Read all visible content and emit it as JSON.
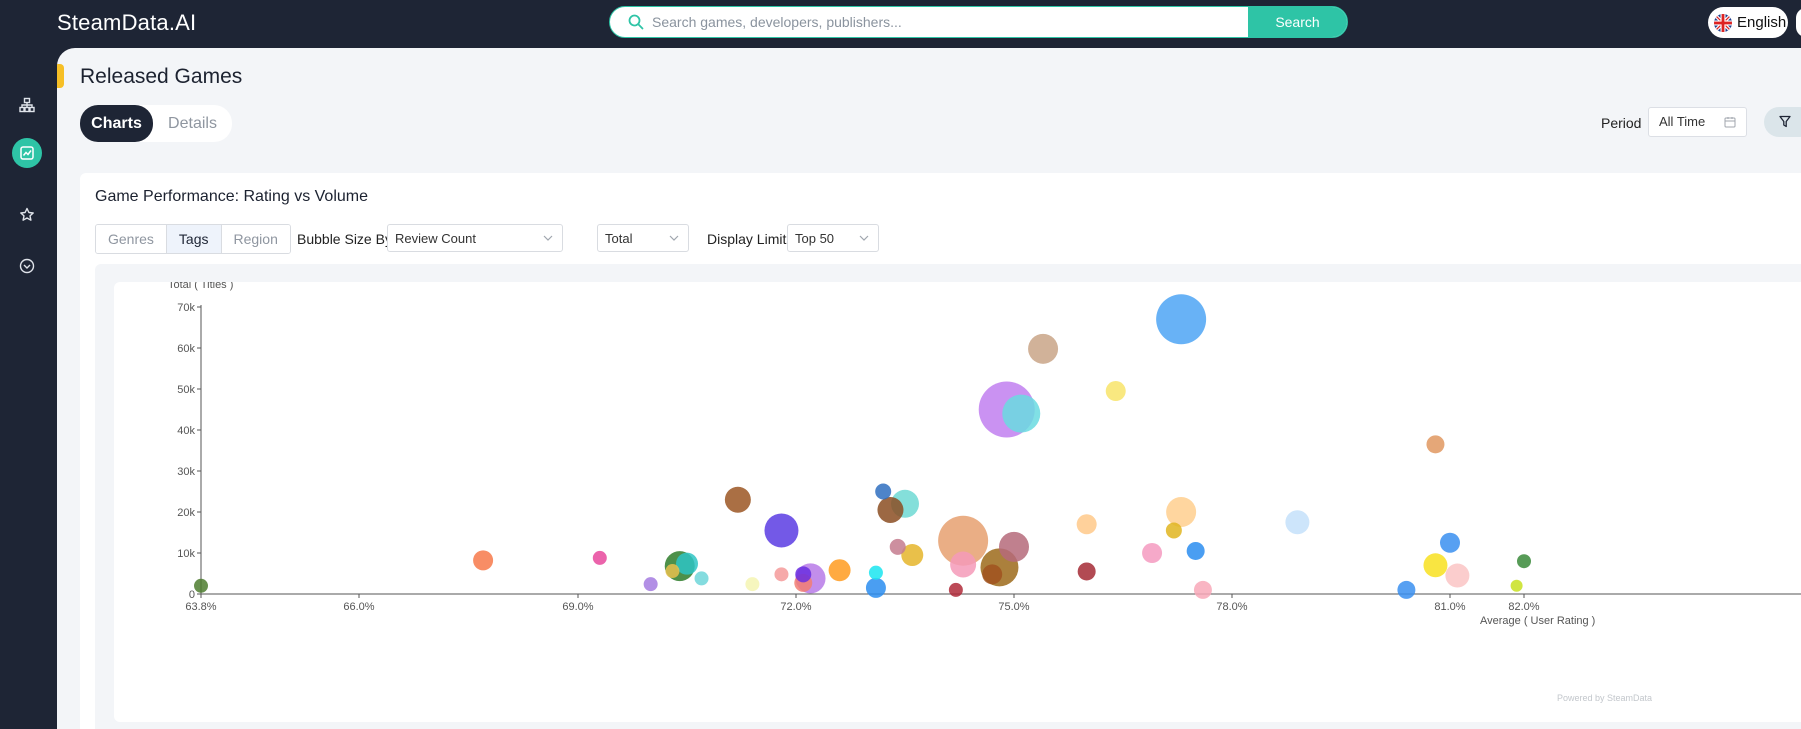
{
  "app": {
    "logo": "SteamData.AI",
    "search": {
      "placeholder": "Search games, developers, publishers...",
      "button_label": "Search"
    },
    "language": "English"
  },
  "sidebar": {
    "items": [
      {
        "icon": "hierarchy-icon",
        "active": false
      },
      {
        "icon": "trend-chart-icon",
        "active": true
      },
      {
        "icon": "star-icon",
        "active": false
      },
      {
        "icon": "chevron-circle-icon",
        "active": false
      }
    ]
  },
  "page": {
    "title": "Released Games",
    "view_tabs": [
      "Charts",
      "Details"
    ],
    "active_tab": "Charts",
    "period_label": "Period",
    "period_value": "All Time"
  },
  "card": {
    "title": "Game Performance: Rating vs Volume",
    "segments": [
      "Genres",
      "Tags",
      "Region"
    ],
    "active_segment": "Tags",
    "bubble_size_label": "Bubble Size By",
    "bubble_size_value": "Review Count",
    "metric_value": "Total",
    "display_limit_label": "Display Limit",
    "display_limit_value": "Top 50",
    "powered_by": "Powered by SteamData"
  },
  "chart_data": {
    "type": "scatter",
    "ylabel": "Total ( Titles )",
    "xlabel": "Average ( User Rating )",
    "y_ticks": [
      "0",
      "10k",
      "20k",
      "30k",
      "40k",
      "50k",
      "60k",
      "70k"
    ],
    "y_tick_values": [
      0,
      10000,
      20000,
      30000,
      40000,
      50000,
      60000,
      70000
    ],
    "x_ticks": [
      "63.8%",
      "66.0%",
      "69.0%",
      "72.0%",
      "75.0%",
      "78.0%",
      "81.0%",
      "82.0%"
    ],
    "x_tick_values": [
      63.8,
      66.0,
      69.0,
      72.0,
      75.0,
      78.0,
      81.0,
      82.0
    ],
    "xlim": [
      63.8,
      82.0
    ],
    "ylim": [
      0,
      70000
    ],
    "points": [
      {
        "x": 63.8,
        "y": 2000,
        "size": 7,
        "color": "#4e7d2f"
      },
      {
        "x": 67.7,
        "y": 8200,
        "size": 10,
        "color": "#f7794a"
      },
      {
        "x": 69.3,
        "y": 8800,
        "size": 7,
        "color": "#e8489c"
      },
      {
        "x": 70.0,
        "y": 2400,
        "size": 7,
        "color": "#a57be0"
      },
      {
        "x": 70.4,
        "y": 6800,
        "size": 15,
        "color": "#2e7d2a"
      },
      {
        "x": 70.5,
        "y": 7400,
        "size": 11,
        "color": "#2ec4c4"
      },
      {
        "x": 70.3,
        "y": 5600,
        "size": 7,
        "color": "#e7c14e"
      },
      {
        "x": 70.7,
        "y": 3800,
        "size": 7,
        "color": "#6fd6d9"
      },
      {
        "x": 71.2,
        "y": 23000,
        "size": 13,
        "color": "#9b5623"
      },
      {
        "x": 71.4,
        "y": 2400,
        "size": 7,
        "color": "#f4f4b3"
      },
      {
        "x": 71.8,
        "y": 4800,
        "size": 7,
        "color": "#f59a9a"
      },
      {
        "x": 71.8,
        "y": 15500,
        "size": 17,
        "color": "#5b3ce3"
      },
      {
        "x": 72.1,
        "y": 2700,
        "size": 9,
        "color": "#f27e72"
      },
      {
        "x": 72.1,
        "y": 4800,
        "size": 8,
        "color": "#6a2ee0"
      },
      {
        "x": 72.2,
        "y": 3800,
        "size": 15,
        "color": "#b77ae8"
      },
      {
        "x": 72.6,
        "y": 5800,
        "size": 11,
        "color": "#ff9b20"
      },
      {
        "x": 73.1,
        "y": 1500,
        "size": 10,
        "color": "#2a8df0"
      },
      {
        "x": 73.1,
        "y": 5200,
        "size": 7,
        "color": "#1ae5f0"
      },
      {
        "x": 73.2,
        "y": 25000,
        "size": 8,
        "color": "#2f6fbf"
      },
      {
        "x": 73.3,
        "y": 20500,
        "size": 13,
        "color": "#8b4d22"
      },
      {
        "x": 73.4,
        "y": 11500,
        "size": 8,
        "color": "#c47b8e"
      },
      {
        "x": 73.5,
        "y": 22000,
        "size": 14,
        "color": "#6fd9d4"
      },
      {
        "x": 73.6,
        "y": 9500,
        "size": 11,
        "color": "#e5b52a"
      },
      {
        "x": 74.2,
        "y": 1000,
        "size": 7,
        "color": "#b02a3a"
      },
      {
        "x": 74.3,
        "y": 7200,
        "size": 13,
        "color": "#f59ab8"
      },
      {
        "x": 74.3,
        "y": 13000,
        "size": 25,
        "color": "#e6a070"
      },
      {
        "x": 74.7,
        "y": 4800,
        "size": 10,
        "color": "#a0521f"
      },
      {
        "x": 74.8,
        "y": 6500,
        "size": 19,
        "color": "#9c6a1a"
      },
      {
        "x": 75.0,
        "y": 11500,
        "size": 15,
        "color": "#b56a7a"
      },
      {
        "x": 74.9,
        "y": 45000,
        "size": 28,
        "color": "#c17ff0"
      },
      {
        "x": 75.1,
        "y": 44000,
        "size": 19,
        "color": "#6adbe0"
      },
      {
        "x": 75.4,
        "y": 59800,
        "size": 15,
        "color": "#c9a487"
      },
      {
        "x": 76.0,
        "y": 5500,
        "size": 9,
        "color": "#a52a35"
      },
      {
        "x": 76.0,
        "y": 17000,
        "size": 10,
        "color": "#ffc98a"
      },
      {
        "x": 76.4,
        "y": 49500,
        "size": 10,
        "color": "#f8e46a"
      },
      {
        "x": 76.9,
        "y": 10000,
        "size": 10,
        "color": "#f59ac0"
      },
      {
        "x": 77.2,
        "y": 15500,
        "size": 8,
        "color": "#e0b520"
      },
      {
        "x": 77.3,
        "y": 20000,
        "size": 15,
        "color": "#ffcf8e"
      },
      {
        "x": 77.3,
        "y": 67000,
        "size": 25,
        "color": "#4ea5f5"
      },
      {
        "x": 77.5,
        "y": 10500,
        "size": 9,
        "color": "#2a8df0"
      },
      {
        "x": 77.6,
        "y": 1000,
        "size": 9,
        "color": "#f8a8b8"
      },
      {
        "x": 78.9,
        "y": 17500,
        "size": 12,
        "color": "#c4e0fa"
      },
      {
        "x": 80.4,
        "y": 1000,
        "size": 9,
        "color": "#3a8ff0"
      },
      {
        "x": 80.8,
        "y": 7000,
        "size": 12,
        "color": "#f8e020"
      },
      {
        "x": 80.8,
        "y": 36500,
        "size": 9,
        "color": "#e09860"
      },
      {
        "x": 81.0,
        "y": 12500,
        "size": 10,
        "color": "#3a8ff0"
      },
      {
        "x": 81.1,
        "y": 4500,
        "size": 12,
        "color": "#fac4c4"
      },
      {
        "x": 81.9,
        "y": 2000,
        "size": 6,
        "color": "#c8e020"
      },
      {
        "x": 82.0,
        "y": 8000,
        "size": 7,
        "color": "#3a8a3a"
      }
    ]
  }
}
